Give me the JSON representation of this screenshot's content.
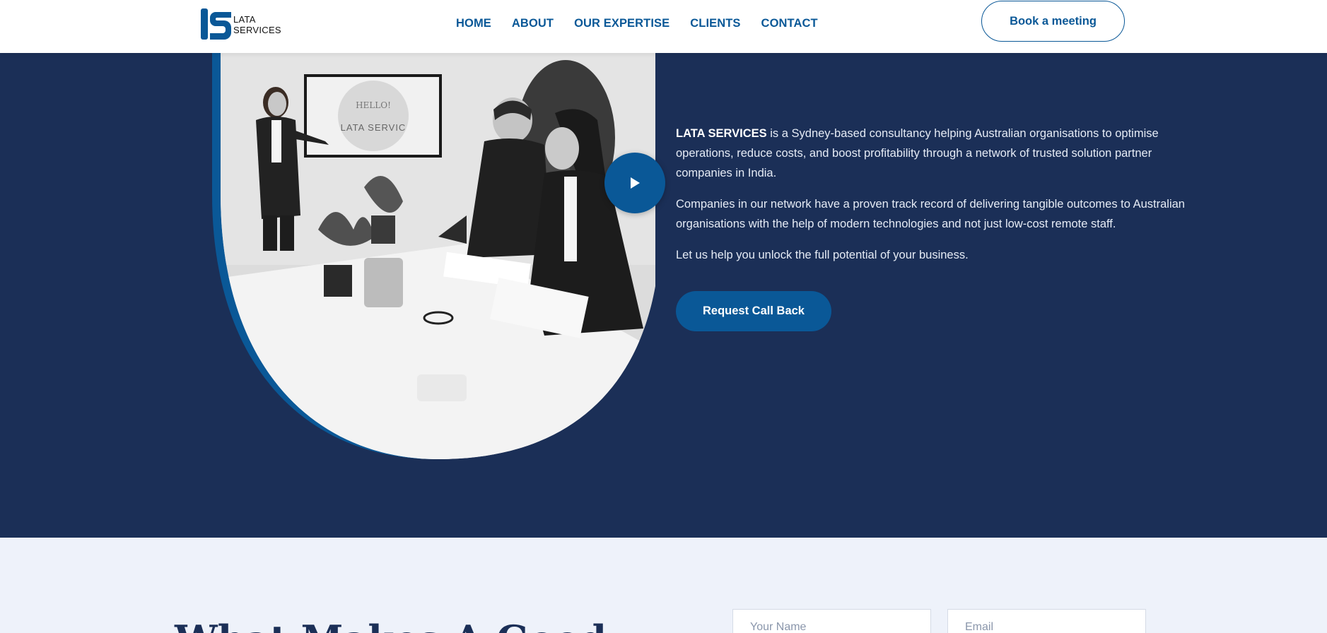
{
  "header": {
    "logo": {
      "line1": "LATA",
      "line2": "SERVICES"
    },
    "nav": [
      "HOME",
      "ABOUT",
      "OUR EXPERTISE",
      "CLIENTS",
      "CONTACT"
    ],
    "cta": "Book a meeting"
  },
  "hero": {
    "screen_text": {
      "line1": "HELLO!",
      "line2": "LATA SERVIC"
    },
    "about": {
      "brand": "LATA SERVICES",
      "p1_rest": " is a Sydney-based consultancy helping Australian organisations  to optimise  operations, reduce costs, and boost profitability through a network of trusted solution partner companies in India.",
      "p2": "Companies in our network have a proven track record of delivering tangible outcomes to Australian organisations with the help of modern technologies and not just low-cost remote staff.",
      "p3": "Let us help you unlock the full potential of your business."
    },
    "cta": "Request Call Back"
  },
  "lower": {
    "heading": "What Makes A Good",
    "name_placeholder": "Your Name",
    "email_placeholder": "Email"
  },
  "colors": {
    "brand_blue": "#0a5897",
    "navy": "#1b2f57",
    "light_bg": "#eef2fa"
  }
}
